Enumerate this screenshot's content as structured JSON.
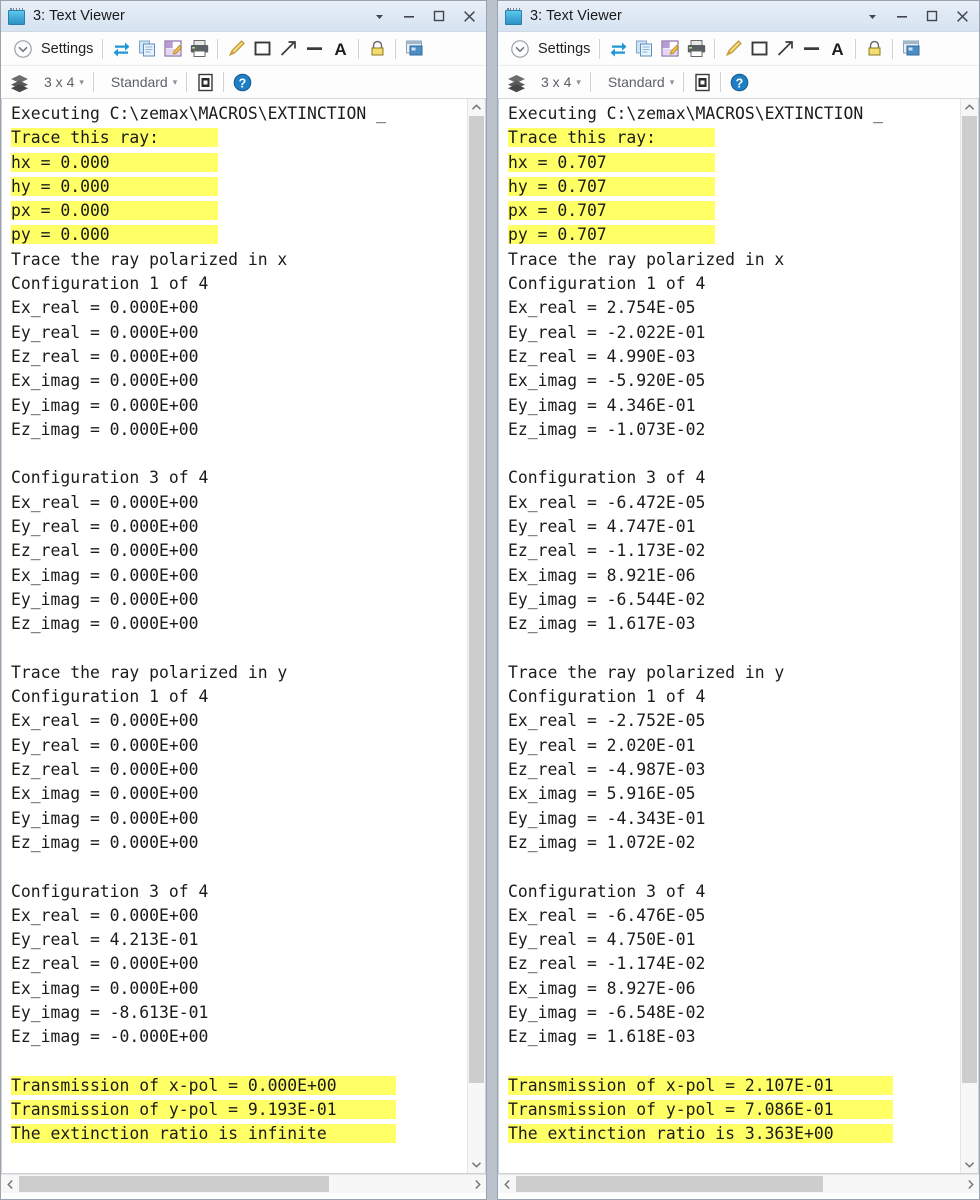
{
  "window": {
    "title": "3: Text Viewer",
    "icon": "notepad-icon",
    "buttons": {
      "dropdown": "▼",
      "minimize": "–",
      "maximize": "☐",
      "close": "✕"
    }
  },
  "toolbar": {
    "settings_label": "Settings",
    "icons_row1": [
      "refresh-icon",
      "copy-icon",
      "save-icon",
      "print-icon",
      "pencil-icon",
      "rectangle-icon",
      "arrow-icon",
      "line-icon",
      "text-icon",
      "lock-icon",
      "window-icon"
    ],
    "layers_icon": "layers-icon",
    "grid_value": "3 x 4",
    "style_value": "Standard",
    "page_icon": "page-setup-icon",
    "help_icon": "help-icon",
    "caret": "▾"
  },
  "scrollbars": {
    "up_arrow": "chevron-up-icon",
    "down_arrow": "chevron-down-icon",
    "left_arrow": "chevron-left-icon",
    "right_arrow": "chevron-right-icon"
  },
  "left_panel": {
    "lines": [
      {
        "text": "Executing C:\\zemax\\MACROS\\EXTINCTION _",
        "hl": false
      },
      {
        "text": "Trace this ray:",
        "hl": true,
        "hlwidth": 21
      },
      {
        "text": "hx = 0.000",
        "hl": true,
        "hlwidth": 21
      },
      {
        "text": "hy = 0.000",
        "hl": true,
        "hlwidth": 21
      },
      {
        "text": "px = 0.000",
        "hl": true,
        "hlwidth": 21
      },
      {
        "text": "py = 0.000",
        "hl": true,
        "hlwidth": 21
      },
      {
        "text": "Trace the ray polarized in x",
        "hl": false
      },
      {
        "text": "Configuration 1 of 4",
        "hl": false
      },
      {
        "text": "Ex_real = 0.000E+00",
        "hl": false
      },
      {
        "text": "Ey_real = 0.000E+00",
        "hl": false
      },
      {
        "text": "Ez_real = 0.000E+00",
        "hl": false
      },
      {
        "text": "Ex_imag = 0.000E+00",
        "hl": false
      },
      {
        "text": "Ey_imag = 0.000E+00",
        "hl": false
      },
      {
        "text": "Ez_imag = 0.000E+00",
        "hl": false
      },
      {
        "text": "",
        "hl": false
      },
      {
        "text": "Configuration 3 of 4",
        "hl": false
      },
      {
        "text": "Ex_real = 0.000E+00",
        "hl": false
      },
      {
        "text": "Ey_real = 0.000E+00",
        "hl": false
      },
      {
        "text": "Ez_real = 0.000E+00",
        "hl": false
      },
      {
        "text": "Ex_imag = 0.000E+00",
        "hl": false
      },
      {
        "text": "Ey_imag = 0.000E+00",
        "hl": false
      },
      {
        "text": "Ez_imag = 0.000E+00",
        "hl": false
      },
      {
        "text": "",
        "hl": false
      },
      {
        "text": "Trace the ray polarized in y",
        "hl": false
      },
      {
        "text": "Configuration 1 of 4",
        "hl": false
      },
      {
        "text": "Ex_real = 0.000E+00",
        "hl": false
      },
      {
        "text": "Ey_real = 0.000E+00",
        "hl": false
      },
      {
        "text": "Ez_real = 0.000E+00",
        "hl": false
      },
      {
        "text": "Ex_imag = 0.000E+00",
        "hl": false
      },
      {
        "text": "Ey_imag = 0.000E+00",
        "hl": false
      },
      {
        "text": "Ez_imag = 0.000E+00",
        "hl": false
      },
      {
        "text": "",
        "hl": false
      },
      {
        "text": "Configuration 3 of 4",
        "hl": false
      },
      {
        "text": "Ex_real = 0.000E+00",
        "hl": false
      },
      {
        "text": "Ey_real = 4.213E-01",
        "hl": false
      },
      {
        "text": "Ez_real = 0.000E+00",
        "hl": false
      },
      {
        "text": "Ex_imag = 0.000E+00",
        "hl": false
      },
      {
        "text": "Ey_imag = -8.613E-01",
        "hl": false
      },
      {
        "text": "Ez_imag = -0.000E+00",
        "hl": false
      },
      {
        "text": "",
        "hl": false
      },
      {
        "text": "Transmission of x-pol = 0.000E+00",
        "hl": true,
        "hlwidth": 39
      },
      {
        "text": "Transmission of y-pol = 9.193E-01",
        "hl": true,
        "hlwidth": 39
      },
      {
        "text": "The extinction ratio is infinite",
        "hl": true,
        "hlwidth": 39
      }
    ]
  },
  "right_panel": {
    "lines": [
      {
        "text": "Executing C:\\zemax\\MACROS\\EXTINCTION _",
        "hl": false
      },
      {
        "text": "Trace this ray:",
        "hl": true,
        "hlwidth": 21
      },
      {
        "text": "hx = 0.707",
        "hl": true,
        "hlwidth": 21
      },
      {
        "text": "hy = 0.707",
        "hl": true,
        "hlwidth": 21
      },
      {
        "text": "px = 0.707",
        "hl": true,
        "hlwidth": 21
      },
      {
        "text": "py = 0.707",
        "hl": true,
        "hlwidth": 21
      },
      {
        "text": "Trace the ray polarized in x",
        "hl": false
      },
      {
        "text": "Configuration 1 of 4",
        "hl": false
      },
      {
        "text": "Ex_real = 2.754E-05",
        "hl": false
      },
      {
        "text": "Ey_real = -2.022E-01",
        "hl": false
      },
      {
        "text": "Ez_real = 4.990E-03",
        "hl": false
      },
      {
        "text": "Ex_imag = -5.920E-05",
        "hl": false
      },
      {
        "text": "Ey_imag = 4.346E-01",
        "hl": false
      },
      {
        "text": "Ez_imag = -1.073E-02",
        "hl": false
      },
      {
        "text": "",
        "hl": false
      },
      {
        "text": "Configuration 3 of 4",
        "hl": false
      },
      {
        "text": "Ex_real = -6.472E-05",
        "hl": false
      },
      {
        "text": "Ey_real = 4.747E-01",
        "hl": false
      },
      {
        "text": "Ez_real = -1.173E-02",
        "hl": false
      },
      {
        "text": "Ex_imag = 8.921E-06",
        "hl": false
      },
      {
        "text": "Ey_imag = -6.544E-02",
        "hl": false
      },
      {
        "text": "Ez_imag = 1.617E-03",
        "hl": false
      },
      {
        "text": "",
        "hl": false
      },
      {
        "text": "Trace the ray polarized in y",
        "hl": false
      },
      {
        "text": "Configuration 1 of 4",
        "hl": false
      },
      {
        "text": "Ex_real = -2.752E-05",
        "hl": false
      },
      {
        "text": "Ey_real = 2.020E-01",
        "hl": false
      },
      {
        "text": "Ez_real = -4.987E-03",
        "hl": false
      },
      {
        "text": "Ex_imag = 5.916E-05",
        "hl": false
      },
      {
        "text": "Ey_imag = -4.343E-01",
        "hl": false
      },
      {
        "text": "Ez_imag = 1.072E-02",
        "hl": false
      },
      {
        "text": "",
        "hl": false
      },
      {
        "text": "Configuration 3 of 4",
        "hl": false
      },
      {
        "text": "Ex_real = -6.476E-05",
        "hl": false
      },
      {
        "text": "Ey_real = 4.750E-01",
        "hl": false
      },
      {
        "text": "Ez_real = -1.174E-02",
        "hl": false
      },
      {
        "text": "Ex_imag = 8.927E-06",
        "hl": false
      },
      {
        "text": "Ey_imag = -6.548E-02",
        "hl": false
      },
      {
        "text": "Ez_imag = 1.618E-03",
        "hl": false
      },
      {
        "text": "",
        "hl": false
      },
      {
        "text": "Transmission of x-pol = 2.107E-01",
        "hl": true,
        "hlwidth": 39
      },
      {
        "text": "Transmission of y-pol = 7.086E-01",
        "hl": true,
        "hlwidth": 39
      },
      {
        "text": "The extinction ratio is 3.363E+00",
        "hl": true,
        "hlwidth": 39
      }
    ]
  },
  "colors": {
    "highlight": "#ffff66",
    "title_gradient_top": "#e9f0f8",
    "title_gradient_bottom": "#d6e3f1",
    "text": "#1b1b1b",
    "desktop": "#b9c1ca"
  }
}
